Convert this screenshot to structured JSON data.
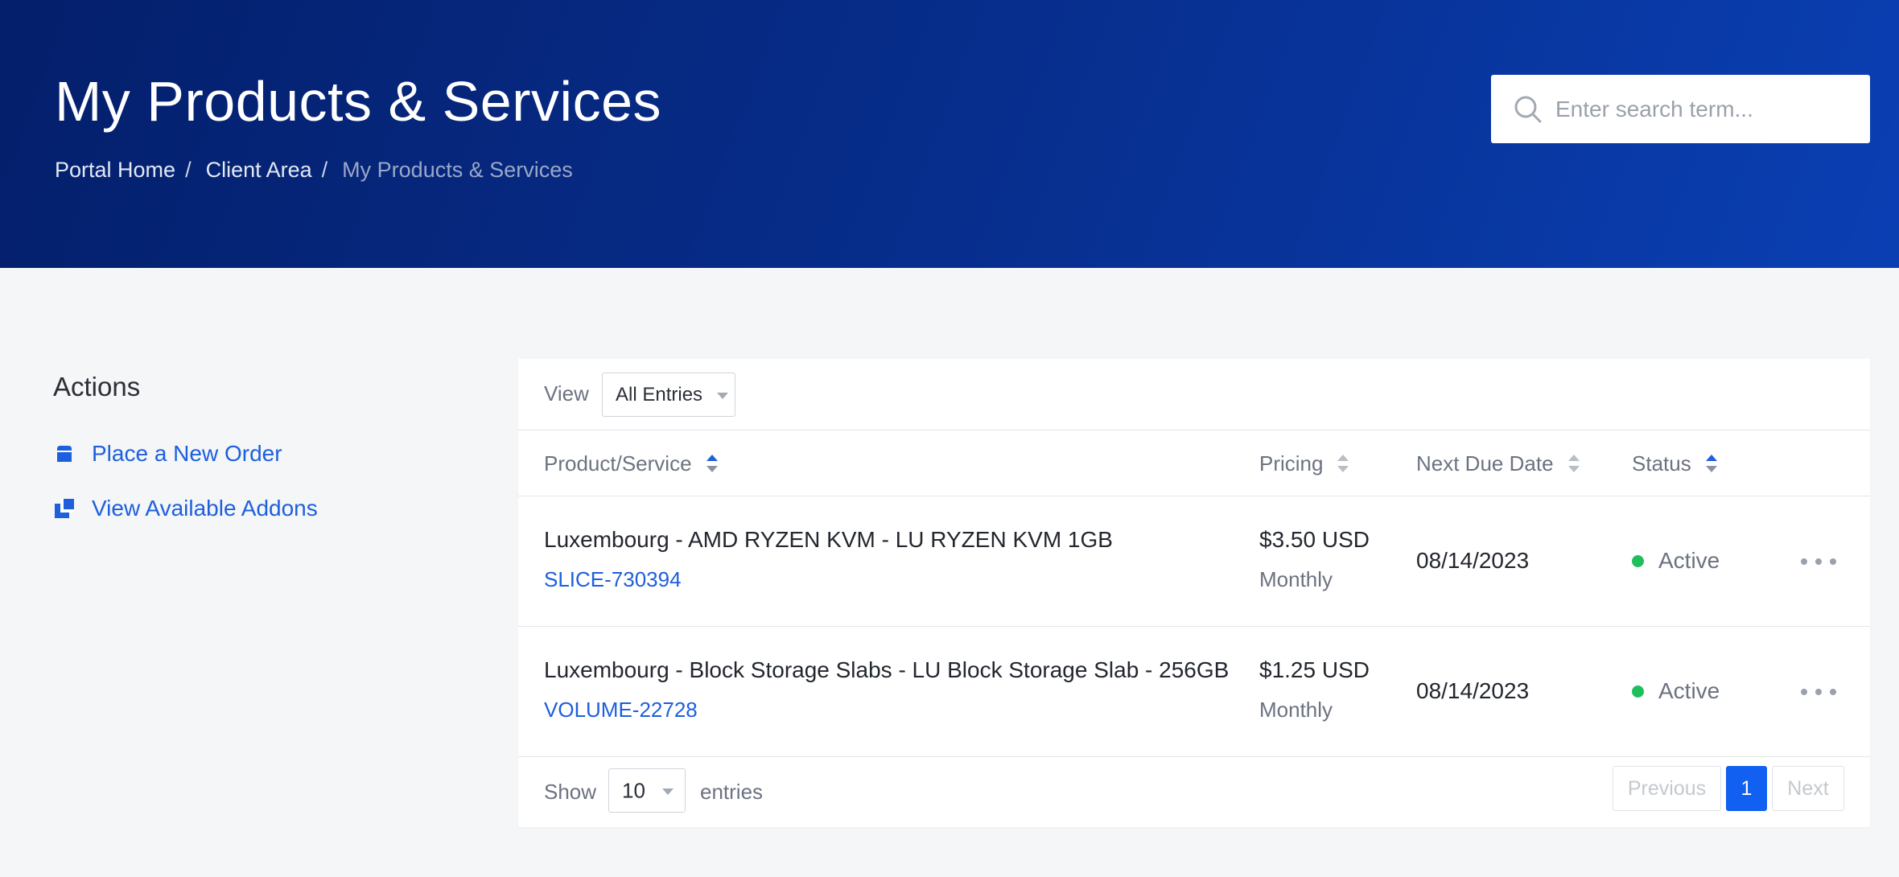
{
  "header": {
    "title": "My Products & Services",
    "breadcrumb": [
      {
        "label": "Portal Home"
      },
      {
        "label": "Client Area"
      },
      {
        "label": "My Products & Services"
      }
    ],
    "breadcrumb_separator": "/",
    "search_placeholder": "Enter search term..."
  },
  "sidebar": {
    "title": "Actions",
    "items": [
      {
        "label": "Place a New Order",
        "icon": "shopping-bag-icon"
      },
      {
        "label": "View Available Addons",
        "icon": "addons-icon"
      }
    ]
  },
  "table": {
    "view_label": "View",
    "view_selected": "All Entries",
    "columns": [
      {
        "label": "Product/Service",
        "sort": "asc"
      },
      {
        "label": "Pricing",
        "sort": "none"
      },
      {
        "label": "Next Due Date",
        "sort": "none"
      },
      {
        "label": "Status",
        "sort": "asc"
      }
    ],
    "rows": [
      {
        "product": "Luxembourg - AMD RYZEN KVM - LU RYZEN KVM 1GB",
        "id": "SLICE-730394",
        "price": "$3.50 USD",
        "cycle": "Monthly",
        "due": "08/14/2023",
        "status": "Active"
      },
      {
        "product": "Luxembourg - Block Storage Slabs - LU Block Storage Slab - 256GB",
        "id": "VOLUME-22728",
        "price": "$1.25 USD",
        "cycle": "Monthly",
        "due": "08/14/2023",
        "status": "Active"
      }
    ],
    "footer": {
      "show_label": "Show",
      "page_length": "10",
      "entries_label": "entries",
      "pagination": {
        "previous": "Previous",
        "current": "1",
        "next": "Next"
      }
    }
  },
  "colors": {
    "hero_start": "#041f6b",
    "hero_end": "#0a3fb3",
    "link": "#1e5fdc",
    "active_page": "#1160f2",
    "status_active": "#1fbf5c"
  }
}
